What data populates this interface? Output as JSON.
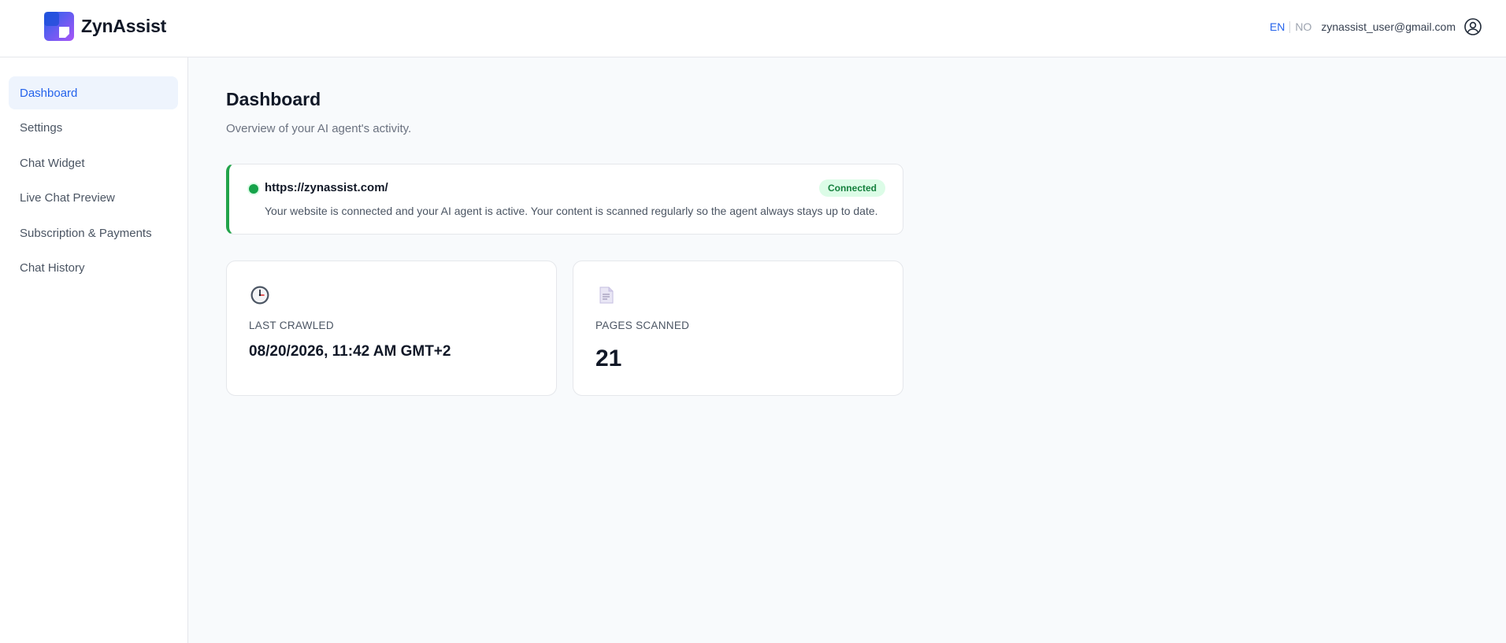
{
  "app": {
    "brand": "ZynAssist",
    "languages": {
      "active": "EN",
      "inactive": "NO"
    },
    "user_email": "zynassist_user@gmail.com"
  },
  "sidebar": {
    "items": [
      {
        "label": "Dashboard",
        "active": true
      },
      {
        "label": "Settings",
        "active": false
      },
      {
        "label": "Chat Widget",
        "active": false
      },
      {
        "label": "Live Chat Preview",
        "active": false
      },
      {
        "label": "Subscription & Payments",
        "active": false
      },
      {
        "label": "Chat History",
        "active": false
      }
    ]
  },
  "main": {
    "title": "Dashboard",
    "subtitle": "Overview of your AI agent's activity.",
    "connection": {
      "url": "https://zynassist.com/",
      "status": "Connected",
      "description": "Your website is connected and your AI agent is active. Your content is scanned regularly so the agent always stays up to date."
    },
    "stats": [
      {
        "icon": "clock-icon",
        "label": "LAST CRAWLED",
        "value": "08/20/2026, 11:42 AM GMT+2"
      },
      {
        "icon": "document-icon",
        "label": "PAGES SCANNED",
        "value": "21"
      }
    ]
  },
  "colors": {
    "accent": "#2563eb",
    "active_bg": "#eef4fd",
    "success": "#16a34a",
    "badge_bg": "#dcfce7",
    "badge_text": "#15803d",
    "logo_gradient": [
      "#2563eb",
      "#a855f7"
    ]
  }
}
